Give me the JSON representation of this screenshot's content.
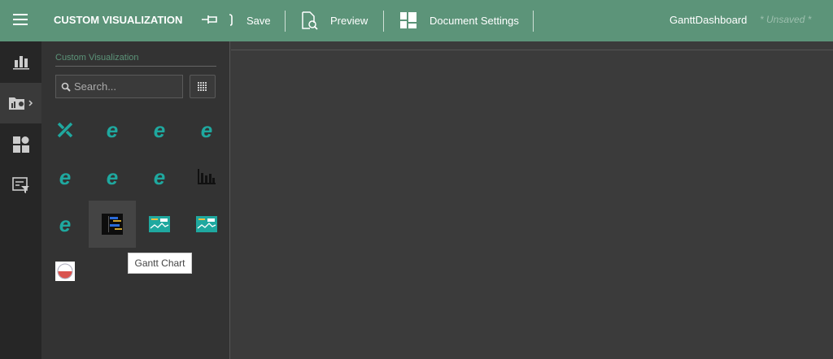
{
  "header": {
    "title": "CUSTOM VISUALIZATION",
    "save": "Save",
    "preview": "Preview",
    "document_settings": "Document Settings",
    "dashboard_name": "GanttDashboard",
    "status": "* Unsaved *",
    "bg": "#5c9479"
  },
  "panel": {
    "title": "Custom Visualization",
    "search_placeholder": "Search..."
  },
  "items": [
    {
      "icon": "tools-icon"
    },
    {
      "icon": "ie-icon"
    },
    {
      "icon": "ie-icon"
    },
    {
      "icon": "ie-icon"
    },
    {
      "icon": "ie-icon"
    },
    {
      "icon": "ie-icon"
    },
    {
      "icon": "ie-icon"
    },
    {
      "icon": "bar-chart-icon"
    },
    {
      "icon": "ie-icon"
    },
    {
      "icon": "gantt-chart-icon"
    },
    {
      "icon": "kpi-icon"
    },
    {
      "icon": "kpi-icon"
    },
    {
      "icon": "gauge-icon"
    }
  ],
  "tooltip": "Gantt Chart"
}
